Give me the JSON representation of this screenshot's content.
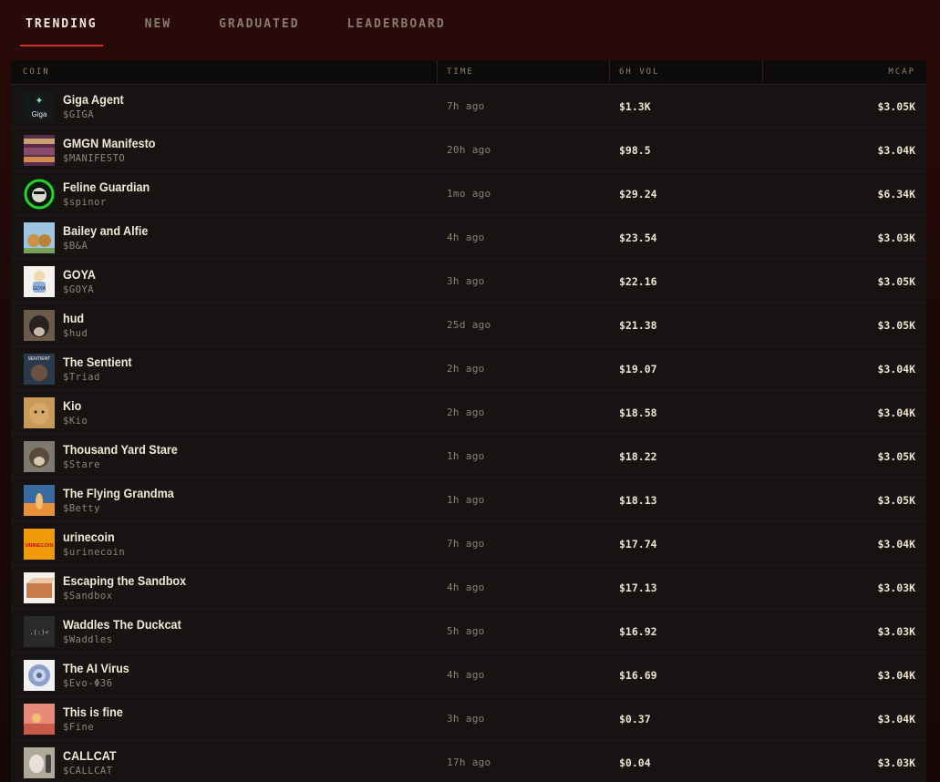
{
  "tabs": [
    {
      "label": "TRENDING",
      "active": true
    },
    {
      "label": "NEW",
      "active": false
    },
    {
      "label": "GRADUATED",
      "active": false
    },
    {
      "label": "LEADERBOARD",
      "active": false
    }
  ],
  "table": {
    "headers": {
      "coin": "COIN",
      "time": "TIME",
      "vol": "6H VOL",
      "mcap": "MCAP"
    },
    "rows": [
      {
        "name": "Giga Agent",
        "ticker": "$GIGA",
        "time": "7h ago",
        "vol": "$1.3K",
        "mcap": "$3.05K",
        "thumb_text": "Giga"
      },
      {
        "name": "GMGN Manifesto",
        "ticker": "$MANIFESTO",
        "time": "20h ago",
        "vol": "$98.5",
        "mcap": "$3.04K"
      },
      {
        "name": "Feline Guardian",
        "ticker": "$spinor",
        "time": "1mo ago",
        "vol": "$29.24",
        "mcap": "$6.34K"
      },
      {
        "name": "Bailey and Alfie",
        "ticker": "$B&A",
        "time": "4h ago",
        "vol": "$23.54",
        "mcap": "$3.03K"
      },
      {
        "name": "GOYA",
        "ticker": "$GOYA",
        "time": "3h ago",
        "vol": "$22.16",
        "mcap": "$3.05K",
        "thumb_text": "GOYA"
      },
      {
        "name": "hud",
        "ticker": "$hud",
        "time": "25d ago",
        "vol": "$21.38",
        "mcap": "$3.05K"
      },
      {
        "name": "The Sentient",
        "ticker": "$Triad",
        "time": "2h ago",
        "vol": "$19.07",
        "mcap": "$3.04K",
        "thumb_text": "SENTIENT"
      },
      {
        "name": "Kio",
        "ticker": "$Kio",
        "time": "2h ago",
        "vol": "$18.58",
        "mcap": "$3.04K"
      },
      {
        "name": "Thousand Yard Stare",
        "ticker": "$Stare",
        "time": "1h ago",
        "vol": "$18.22",
        "mcap": "$3.05K"
      },
      {
        "name": "The Flying Grandma",
        "ticker": "$Betty",
        "time": "1h ago",
        "vol": "$18.13",
        "mcap": "$3.05K"
      },
      {
        "name": "urinecoin",
        "ticker": "$urinecoin",
        "time": "7h ago",
        "vol": "$17.74",
        "mcap": "$3.04K",
        "thumb_text": "URINECOIN"
      },
      {
        "name": "Escaping the Sandbox",
        "ticker": "$Sandbox",
        "time": "4h ago",
        "vol": "$17.13",
        "mcap": "$3.03K"
      },
      {
        "name": "Waddles The Duckcat",
        "ticker": "$Waddles",
        "time": "5h ago",
        "vol": "$16.92",
        "mcap": "$3.03K"
      },
      {
        "name": "The AI Virus",
        "ticker": "$Evo-Φ36",
        "time": "4h ago",
        "vol": "$16.69",
        "mcap": "$3.04K"
      },
      {
        "name": "This is fine",
        "ticker": "$Fine",
        "time": "3h ago",
        "vol": "$0.37",
        "mcap": "$3.04K"
      },
      {
        "name": "CALLCAT",
        "ticker": "$CALLCAT",
        "time": "17h ago",
        "vol": "$0.04",
        "mcap": "$3.03K"
      }
    ]
  },
  "colors": {
    "accent": "#c8321f",
    "background": "#1c0907",
    "table_bg": "#171312"
  }
}
